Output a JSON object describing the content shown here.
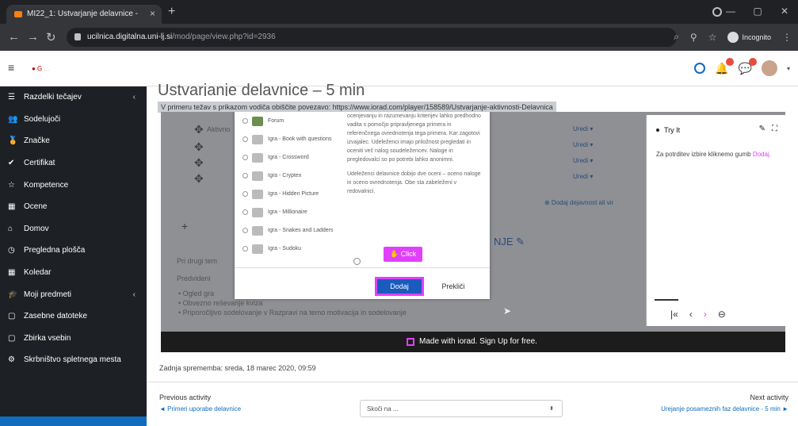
{
  "browser": {
    "tab_title": "MI22_1: Ustvarjanje delavnice -",
    "tab_close": "×",
    "new_tab": "+",
    "url_domain": "ucilnica.digitalna.uni-lj.si",
    "url_path": "/mod/page/view.php?id=2936",
    "incognito_label": "Incognito",
    "icons": [
      "back-icon",
      "forward-icon",
      "reload-icon",
      "lock-icon",
      "search-icon",
      "extension-icon",
      "star-icon",
      "menu-icon"
    ]
  },
  "moodle_nav": {
    "logo_text": "● G",
    "logo_rest": "..."
  },
  "drawer": {
    "items": [
      {
        "icon": "☰",
        "label": "Razdelki tečajev",
        "chevron": "‹"
      },
      {
        "icon": "👥",
        "label": "Sodelujoči"
      },
      {
        "icon": "🏅",
        "label": "Značke"
      },
      {
        "icon": "✔",
        "label": "Certifikat"
      },
      {
        "icon": "☆",
        "label": "Kompetence"
      },
      {
        "icon": "▦",
        "label": "Ocene"
      },
      {
        "icon": "⌂",
        "label": "Domov"
      },
      {
        "icon": "◷",
        "label": "Pregledna plošča"
      },
      {
        "icon": "▦",
        "label": "Koledar"
      },
      {
        "icon": "🎓",
        "label": "Moji predmeti",
        "chevron": "‹"
      },
      {
        "icon": "▢",
        "label": "Zasebne datoteke"
      },
      {
        "icon": "▢",
        "label": "Zbirka vsebin"
      },
      {
        "icon": "⚙",
        "label": "Skrbništvo spletnega mesta"
      }
    ]
  },
  "main": {
    "page_title_partial": "Ustvarjanje delavnice – 5 min",
    "intro": "V primeru težav s prikazom vodiča obiščite povezavo: https://www.iorad.com/player/158589/Ustvarjanje-aktivnosti-Delavnica",
    "modified": "Zadnja sprememba: sreda, 18 marec 2020, 09:59",
    "prev_label": "Previous activity",
    "prev_link": "◄ Primeri uporabe delavnice",
    "jump_placeholder": "Skoči na ...",
    "next_label": "Next activity",
    "next_link": "Urejanje posameznih faz delavnice - 5 min ►"
  },
  "video": {
    "made_with": "Made with iorad. Sign Up for free.",
    "bg_aktivno": "Aktivno",
    "bg_uredi": "Uredi ▾",
    "bg_dodaj_dejavnost": "⊕ Dodaj dejavnost ali vir",
    "bg_heading": "NJE ✎",
    "bg_pri_drugi": "Pri drugi tem",
    "bg_predvideni": "Predvideni",
    "bg_bullet1": "• Ogled gra",
    "bg_bullet2": "• Obvezno reševanje kviza",
    "bg_bullet3": "• Priporočljivo sodelovanje v Razpravi na temo motivacija in sodelovanje",
    "try_title": "Try It",
    "try_text_1": "Za potrditev izbire kliknemo gumb ",
    "try_text_pink": "Dodaj",
    "try_text_2": ".",
    "try_nav": [
      "|«",
      "‹",
      "›",
      "⊖"
    ]
  },
  "modal": {
    "items": [
      {
        "label": "Forum",
        "green": true
      },
      {
        "label": "Igra - Book with questions"
      },
      {
        "label": "Igra - Crossword"
      },
      {
        "label": "Igra - Cryptex"
      },
      {
        "label": "Igra - Hidden Picture"
      },
      {
        "label": "Igra - Millionaire"
      },
      {
        "label": "Igra - Snakes and Ladders"
      },
      {
        "label": "Igra - Sudoku"
      }
    ],
    "desc_1": "ocenjevanju in razumevanju kriterijev lahko predhodno vadita s pomočjo pripravljenega primera in referenčnega ovrednotenja tega primera. Kar zagotovi izvajalec. Udeleženci imajo priložnost pregledati in oceniti več nalog soudeležencev. Naloge in pregledovalci so po potrebi lahko anonimni.",
    "desc_2": "Udeleženci delavnice dobijo dve oceni – oceno naloge in oceno ovrednotenja. Obe sta zabeleženi v redovalnici.",
    "more_help": "Več pomoči",
    "click_hint": "✋ Click",
    "add_button": "Dodaj",
    "cancel_button": "Prekliči"
  }
}
